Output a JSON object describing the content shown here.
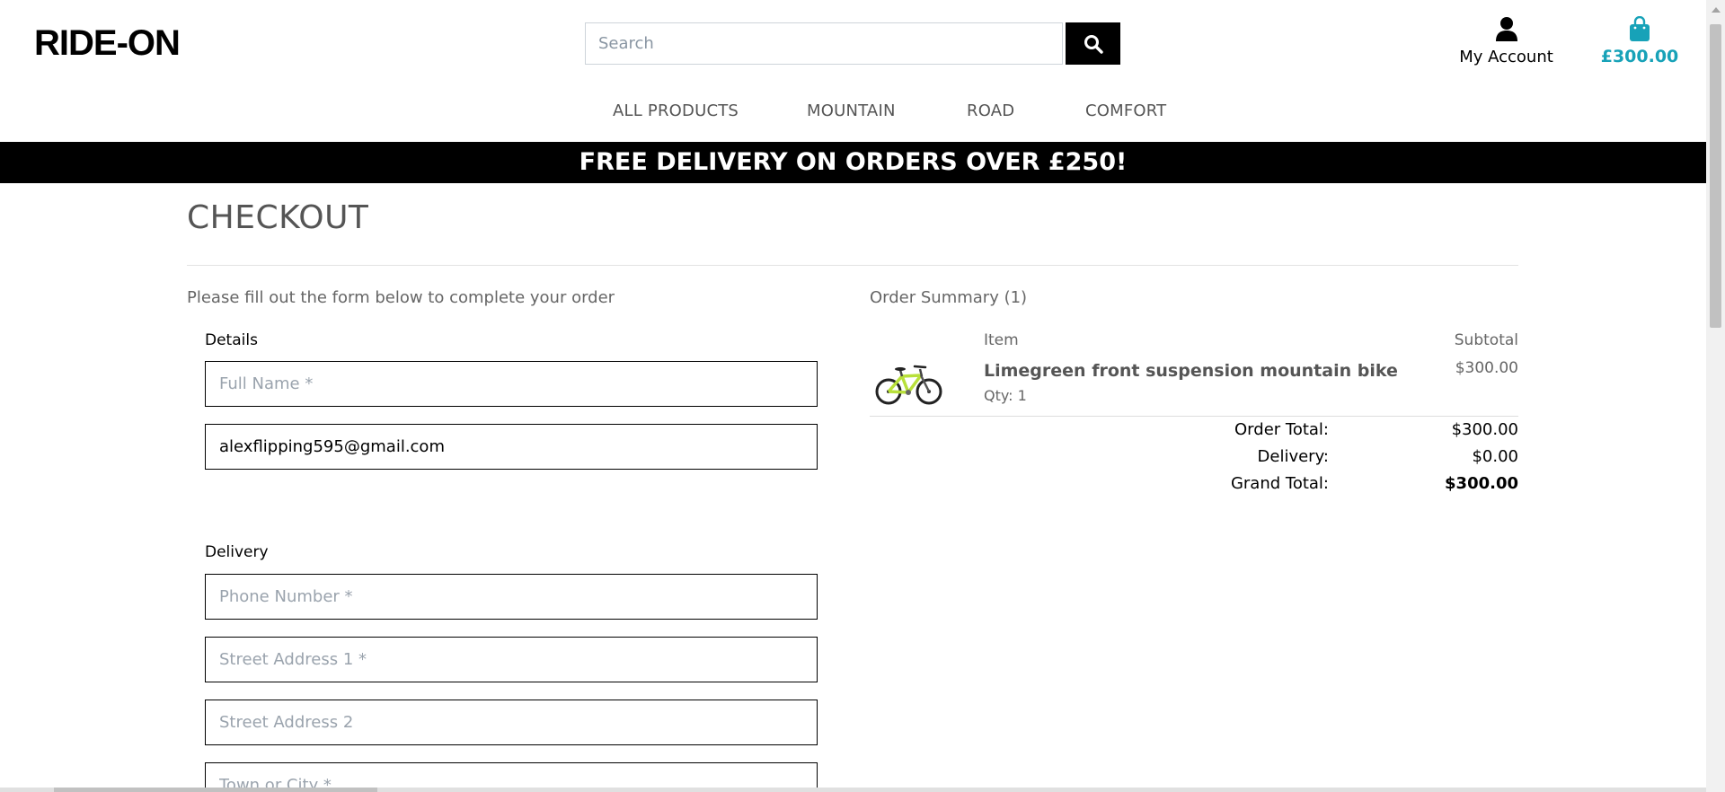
{
  "header": {
    "logo": "RIDE-ON",
    "search_placeholder": "Search",
    "account_label": "My Account",
    "bag_total": "£300.00",
    "accent_color": "#17a2b8"
  },
  "nav": {
    "items": [
      "ALL PRODUCTS",
      "MOUNTAIN",
      "ROAD",
      "COMFORT"
    ]
  },
  "banner": {
    "text": "FREE DELIVERY ON ORDERS OVER £250!"
  },
  "checkout": {
    "title": "CHECKOUT",
    "intro": "Please fill out the form below to complete your order",
    "details_label": "Details",
    "full_name_placeholder": "Full Name *",
    "email_value": "alexflipping595@gmail.com",
    "delivery_label": "Delivery",
    "phone_placeholder": "Phone Number *",
    "street1_placeholder": "Street Address 1 *",
    "street2_placeholder": "Street Address 2",
    "town_placeholder": "Town or City *"
  },
  "summary": {
    "title": "Order Summary (1)",
    "col_item": "Item",
    "col_subtotal": "Subtotal",
    "item_name": "Limegreen front suspension mountain bike",
    "item_qty": "Qty: 1",
    "item_subtotal": "$300.00",
    "order_total_label": "Order Total:",
    "order_total_value": "$300.00",
    "delivery_label": "Delivery:",
    "delivery_value": "$0.00",
    "grand_total_label": "Grand Total:",
    "grand_total_value": "$300.00"
  },
  "icons": {
    "search": "search-icon",
    "account": "user-icon",
    "bag": "shopping-bag-icon",
    "product": "bicycle-image"
  }
}
